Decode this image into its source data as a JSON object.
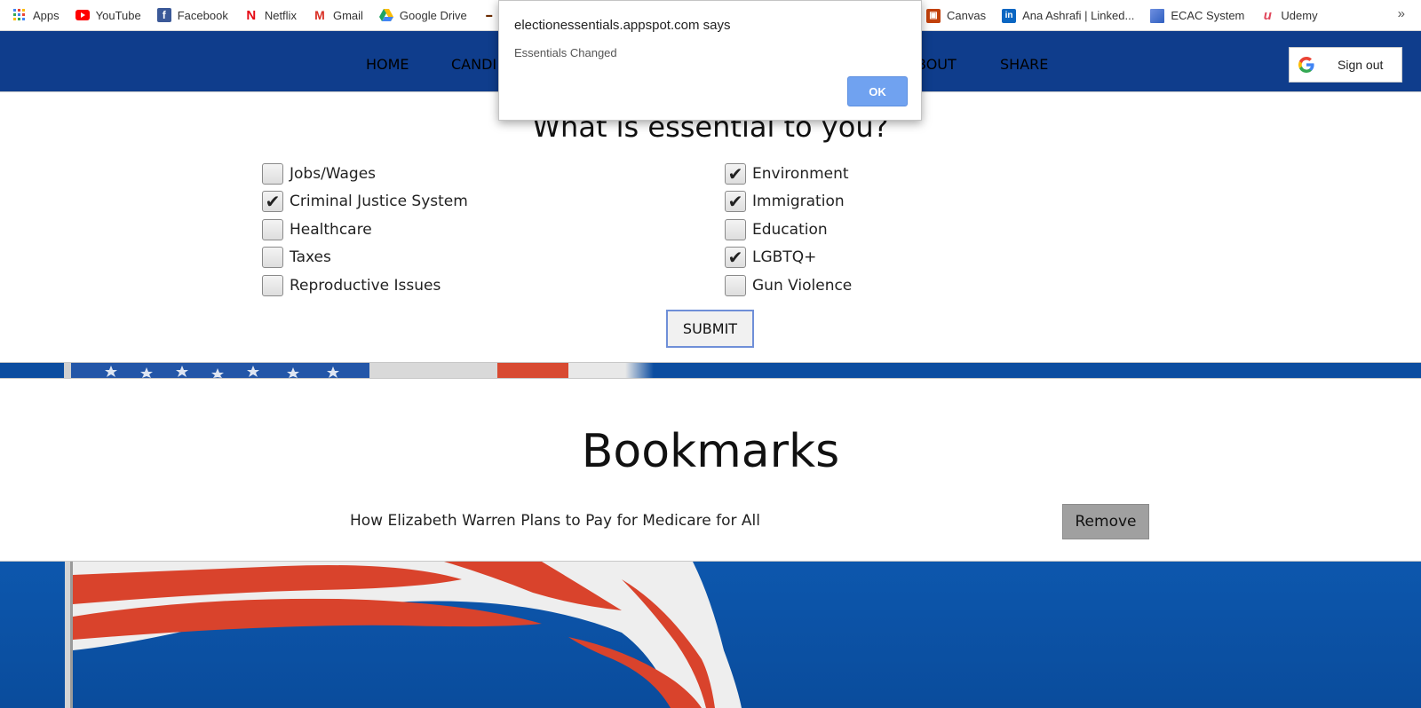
{
  "bookmarks_bar": {
    "items": [
      {
        "label": "Apps",
        "icon": "apps-grid-icon",
        "color": "#4285f4"
      },
      {
        "label": "YouTube",
        "icon": "youtube-icon",
        "color": "#ff0000"
      },
      {
        "label": "Facebook",
        "icon": "facebook-icon",
        "color": "#3b5998"
      },
      {
        "label": "Netflix",
        "icon": "netflix-icon",
        "color": "#e50914"
      },
      {
        "label": "Gmail",
        "icon": "gmail-icon",
        "color": "#d93025"
      },
      {
        "label": "Google Drive",
        "icon": "google-drive-icon",
        "color": "#1fa463"
      }
    ],
    "items_right": [
      {
        "label": "Canvas",
        "icon": "canvas-icon",
        "color": "#c2410c"
      },
      {
        "label": "Ana Ashrafi | Linked...",
        "icon": "linkedin-icon",
        "color": "#0a66c2"
      },
      {
        "label": "ECAC System",
        "icon": "ecac-icon",
        "color": "#3f6fd1"
      },
      {
        "label": "Udemy",
        "icon": "udemy-icon",
        "color": "#e0475b"
      }
    ],
    "more": "»"
  },
  "nav": {
    "links": [
      "HOME",
      "CANDI",
      "BOUT",
      "SHARE"
    ],
    "signout_label": "Sign out"
  },
  "essentials": {
    "title": "What is essential to you?",
    "left": [
      {
        "label": "Jobs/Wages",
        "checked": false
      },
      {
        "label": "Criminal Justice System",
        "checked": true
      },
      {
        "label": "Healthcare",
        "checked": false
      },
      {
        "label": "Taxes",
        "checked": false
      },
      {
        "label": "Reproductive Issues",
        "checked": false
      }
    ],
    "right": [
      {
        "label": "Environment",
        "checked": true
      },
      {
        "label": "Immigration",
        "checked": true
      },
      {
        "label": "Education",
        "checked": false
      },
      {
        "label": "LGBTQ+",
        "checked": true
      },
      {
        "label": "Gun Violence",
        "checked": false
      }
    ],
    "submit_label": "SUBMIT"
  },
  "bookmarks": {
    "title": "Bookmarks",
    "items": [
      {
        "title": "How Elizabeth Warren Plans to Pay for Medicare for All",
        "remove_label": "Remove"
      }
    ]
  },
  "dialog": {
    "title": "electionessentials.appspot.com says",
    "message": "Essentials Changed",
    "ok_label": "OK"
  },
  "colors": {
    "nav_bg": "#0f3d8c",
    "page_bg": "#0b4fa0",
    "ok_button": "#70a2f0",
    "remove_button": "#a0a0a0"
  }
}
